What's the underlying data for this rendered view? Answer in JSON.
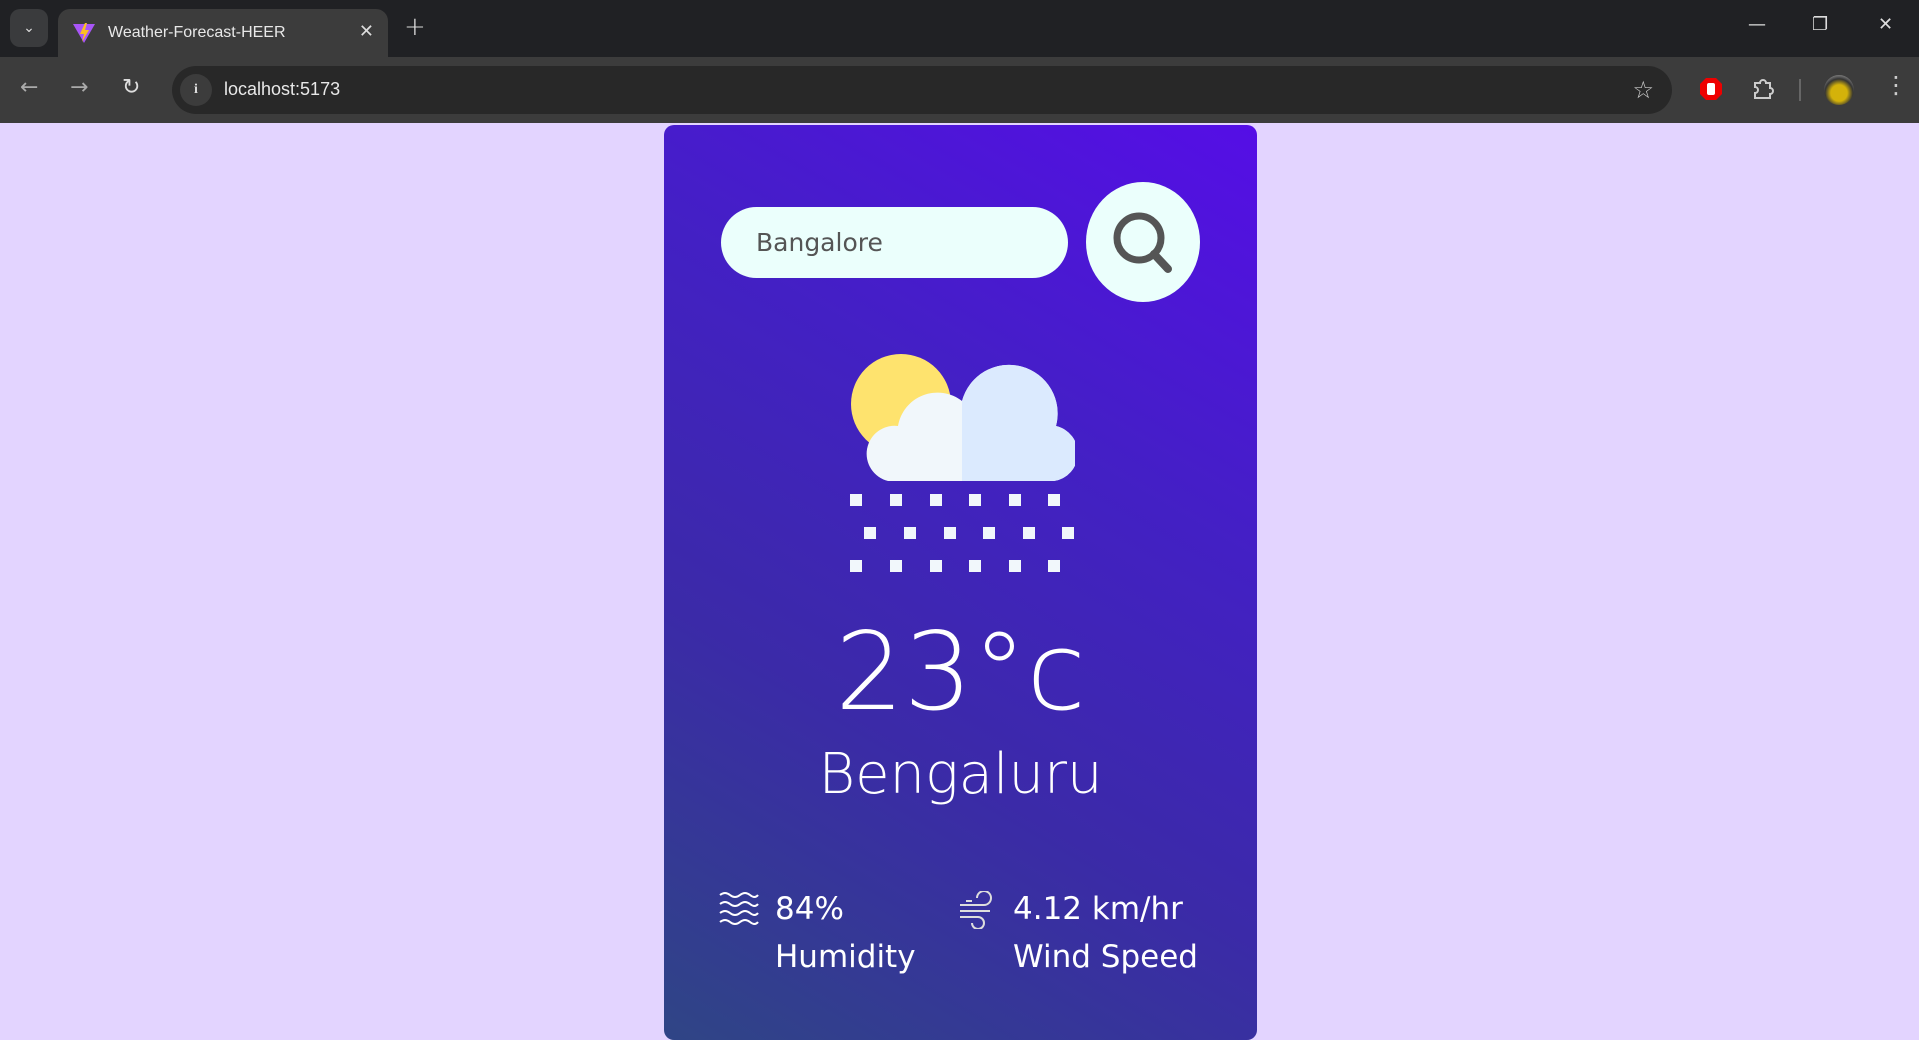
{
  "browser": {
    "tab_title": "Weather-Forecast-HEER",
    "url": "localhost:5173"
  },
  "search": {
    "value": "Bangalore"
  },
  "weather": {
    "temperature": "23°c",
    "city": "Bengaluru",
    "icon": "snow-partly-cloudy-icon"
  },
  "stats": {
    "humidity_value": "84%",
    "humidity_label": "Humidity",
    "wind_value": "4.12 km/hr",
    "wind_label": "Wind Speed"
  },
  "colors": {
    "page_bg": "#e3d4ff",
    "card_top": "#550ee6",
    "card_bottom": "#2f4585"
  }
}
